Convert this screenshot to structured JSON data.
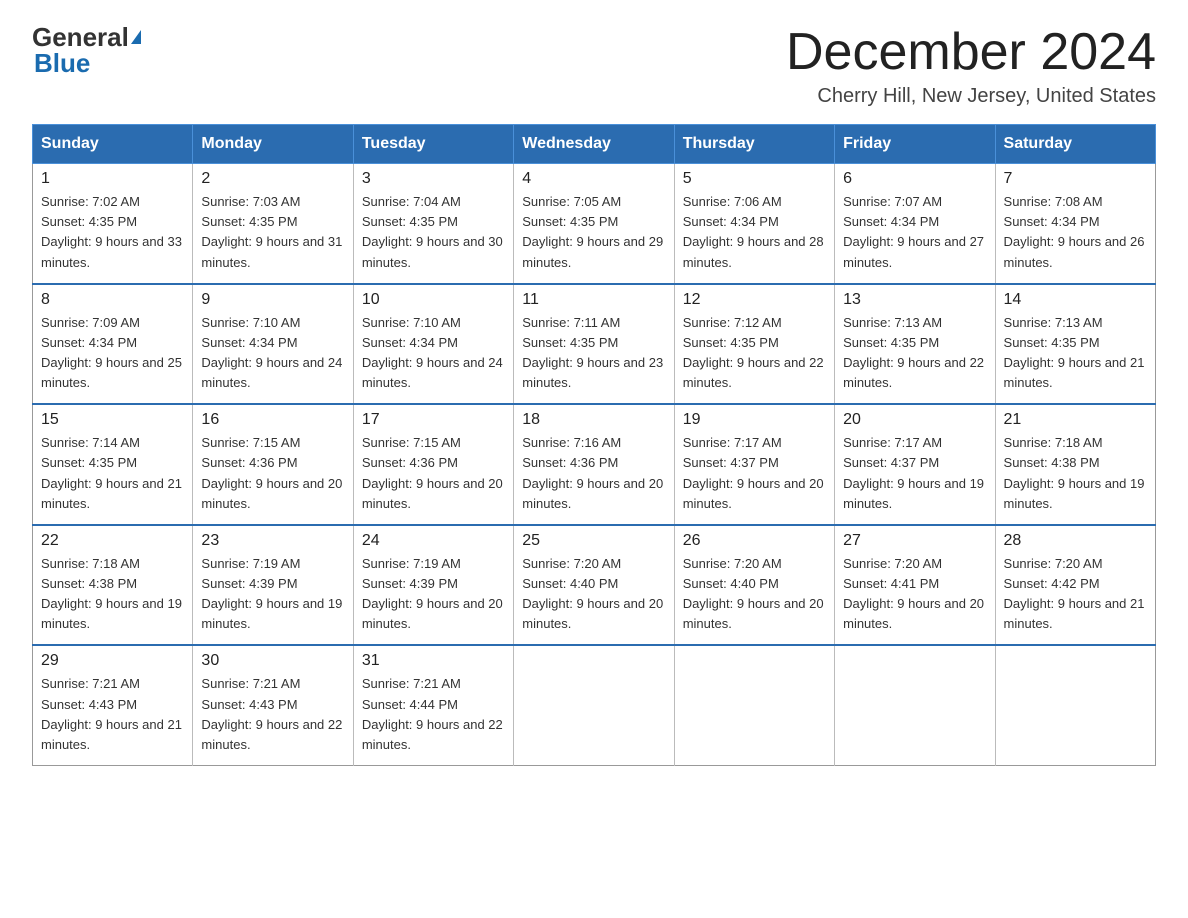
{
  "logo": {
    "top": "General",
    "bottom": "Blue"
  },
  "header": {
    "month_title": "December 2024",
    "location": "Cherry Hill, New Jersey, United States"
  },
  "weekdays": [
    "Sunday",
    "Monday",
    "Tuesday",
    "Wednesday",
    "Thursday",
    "Friday",
    "Saturday"
  ],
  "weeks": [
    [
      {
        "day": "1",
        "sunrise": "7:02 AM",
        "sunset": "4:35 PM",
        "daylight": "9 hours and 33 minutes."
      },
      {
        "day": "2",
        "sunrise": "7:03 AM",
        "sunset": "4:35 PM",
        "daylight": "9 hours and 31 minutes."
      },
      {
        "day": "3",
        "sunrise": "7:04 AM",
        "sunset": "4:35 PM",
        "daylight": "9 hours and 30 minutes."
      },
      {
        "day": "4",
        "sunrise": "7:05 AM",
        "sunset": "4:35 PM",
        "daylight": "9 hours and 29 minutes."
      },
      {
        "day": "5",
        "sunrise": "7:06 AM",
        "sunset": "4:34 PM",
        "daylight": "9 hours and 28 minutes."
      },
      {
        "day": "6",
        "sunrise": "7:07 AM",
        "sunset": "4:34 PM",
        "daylight": "9 hours and 27 minutes."
      },
      {
        "day": "7",
        "sunrise": "7:08 AM",
        "sunset": "4:34 PM",
        "daylight": "9 hours and 26 minutes."
      }
    ],
    [
      {
        "day": "8",
        "sunrise": "7:09 AM",
        "sunset": "4:34 PM",
        "daylight": "9 hours and 25 minutes."
      },
      {
        "day": "9",
        "sunrise": "7:10 AM",
        "sunset": "4:34 PM",
        "daylight": "9 hours and 24 minutes."
      },
      {
        "day": "10",
        "sunrise": "7:10 AM",
        "sunset": "4:34 PM",
        "daylight": "9 hours and 24 minutes."
      },
      {
        "day": "11",
        "sunrise": "7:11 AM",
        "sunset": "4:35 PM",
        "daylight": "9 hours and 23 minutes."
      },
      {
        "day": "12",
        "sunrise": "7:12 AM",
        "sunset": "4:35 PM",
        "daylight": "9 hours and 22 minutes."
      },
      {
        "day": "13",
        "sunrise": "7:13 AM",
        "sunset": "4:35 PM",
        "daylight": "9 hours and 22 minutes."
      },
      {
        "day": "14",
        "sunrise": "7:13 AM",
        "sunset": "4:35 PM",
        "daylight": "9 hours and 21 minutes."
      }
    ],
    [
      {
        "day": "15",
        "sunrise": "7:14 AM",
        "sunset": "4:35 PM",
        "daylight": "9 hours and 21 minutes."
      },
      {
        "day": "16",
        "sunrise": "7:15 AM",
        "sunset": "4:36 PM",
        "daylight": "9 hours and 20 minutes."
      },
      {
        "day": "17",
        "sunrise": "7:15 AM",
        "sunset": "4:36 PM",
        "daylight": "9 hours and 20 minutes."
      },
      {
        "day": "18",
        "sunrise": "7:16 AM",
        "sunset": "4:36 PM",
        "daylight": "9 hours and 20 minutes."
      },
      {
        "day": "19",
        "sunrise": "7:17 AM",
        "sunset": "4:37 PM",
        "daylight": "9 hours and 20 minutes."
      },
      {
        "day": "20",
        "sunrise": "7:17 AM",
        "sunset": "4:37 PM",
        "daylight": "9 hours and 19 minutes."
      },
      {
        "day": "21",
        "sunrise": "7:18 AM",
        "sunset": "4:38 PM",
        "daylight": "9 hours and 19 minutes."
      }
    ],
    [
      {
        "day": "22",
        "sunrise": "7:18 AM",
        "sunset": "4:38 PM",
        "daylight": "9 hours and 19 minutes."
      },
      {
        "day": "23",
        "sunrise": "7:19 AM",
        "sunset": "4:39 PM",
        "daylight": "9 hours and 19 minutes."
      },
      {
        "day": "24",
        "sunrise": "7:19 AM",
        "sunset": "4:39 PM",
        "daylight": "9 hours and 20 minutes."
      },
      {
        "day": "25",
        "sunrise": "7:20 AM",
        "sunset": "4:40 PM",
        "daylight": "9 hours and 20 minutes."
      },
      {
        "day": "26",
        "sunrise": "7:20 AM",
        "sunset": "4:40 PM",
        "daylight": "9 hours and 20 minutes."
      },
      {
        "day": "27",
        "sunrise": "7:20 AM",
        "sunset": "4:41 PM",
        "daylight": "9 hours and 20 minutes."
      },
      {
        "day": "28",
        "sunrise": "7:20 AM",
        "sunset": "4:42 PM",
        "daylight": "9 hours and 21 minutes."
      }
    ],
    [
      {
        "day": "29",
        "sunrise": "7:21 AM",
        "sunset": "4:43 PM",
        "daylight": "9 hours and 21 minutes."
      },
      {
        "day": "30",
        "sunrise": "7:21 AM",
        "sunset": "4:43 PM",
        "daylight": "9 hours and 22 minutes."
      },
      {
        "day": "31",
        "sunrise": "7:21 AM",
        "sunset": "4:44 PM",
        "daylight": "9 hours and 22 minutes."
      },
      null,
      null,
      null,
      null
    ]
  ]
}
